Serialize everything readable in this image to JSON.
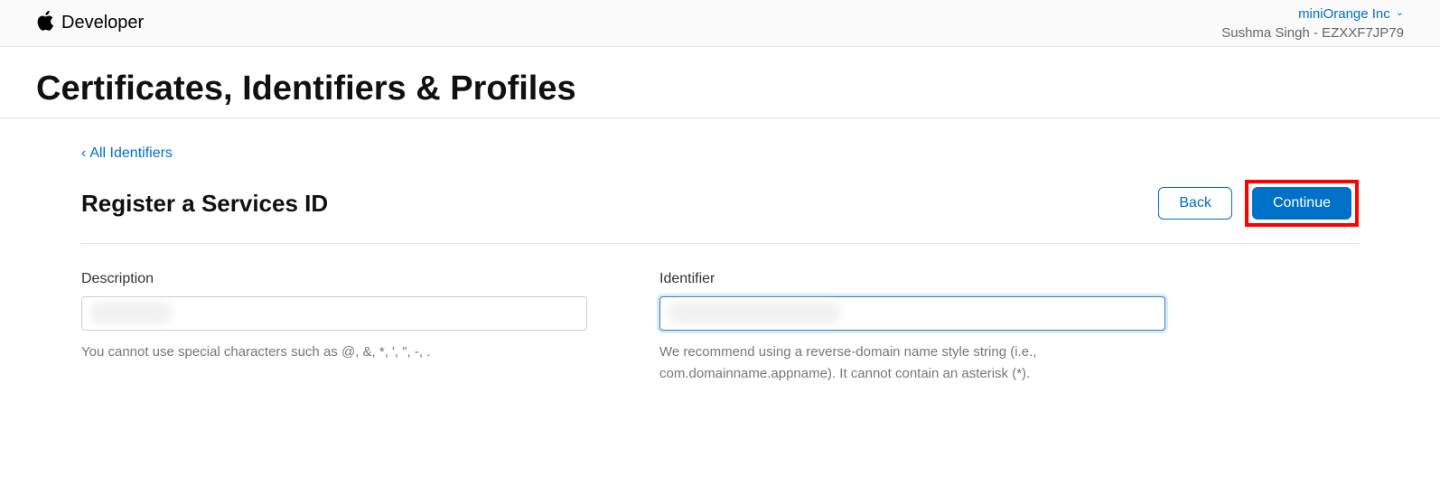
{
  "header": {
    "brand": "Developer",
    "org": "miniOrange Inc",
    "user": "Sushma Singh - EZXXF7JP79"
  },
  "page": {
    "title": "Certificates, Identifiers & Profiles"
  },
  "nav": {
    "back_link": "All Identifiers",
    "back_symbol": "‹"
  },
  "section": {
    "title": "Register a Services ID",
    "back_button": "Back",
    "continue_button": "Continue"
  },
  "form": {
    "description": {
      "label": "Description",
      "value": "",
      "helper": "You cannot use special characters such as @, &, *, ', \", -, ."
    },
    "identifier": {
      "label": "Identifier",
      "value": "",
      "helper": "We recommend using a reverse-domain name style string (i.e., com.domainname.appname). It cannot contain an asterisk (*)."
    }
  }
}
